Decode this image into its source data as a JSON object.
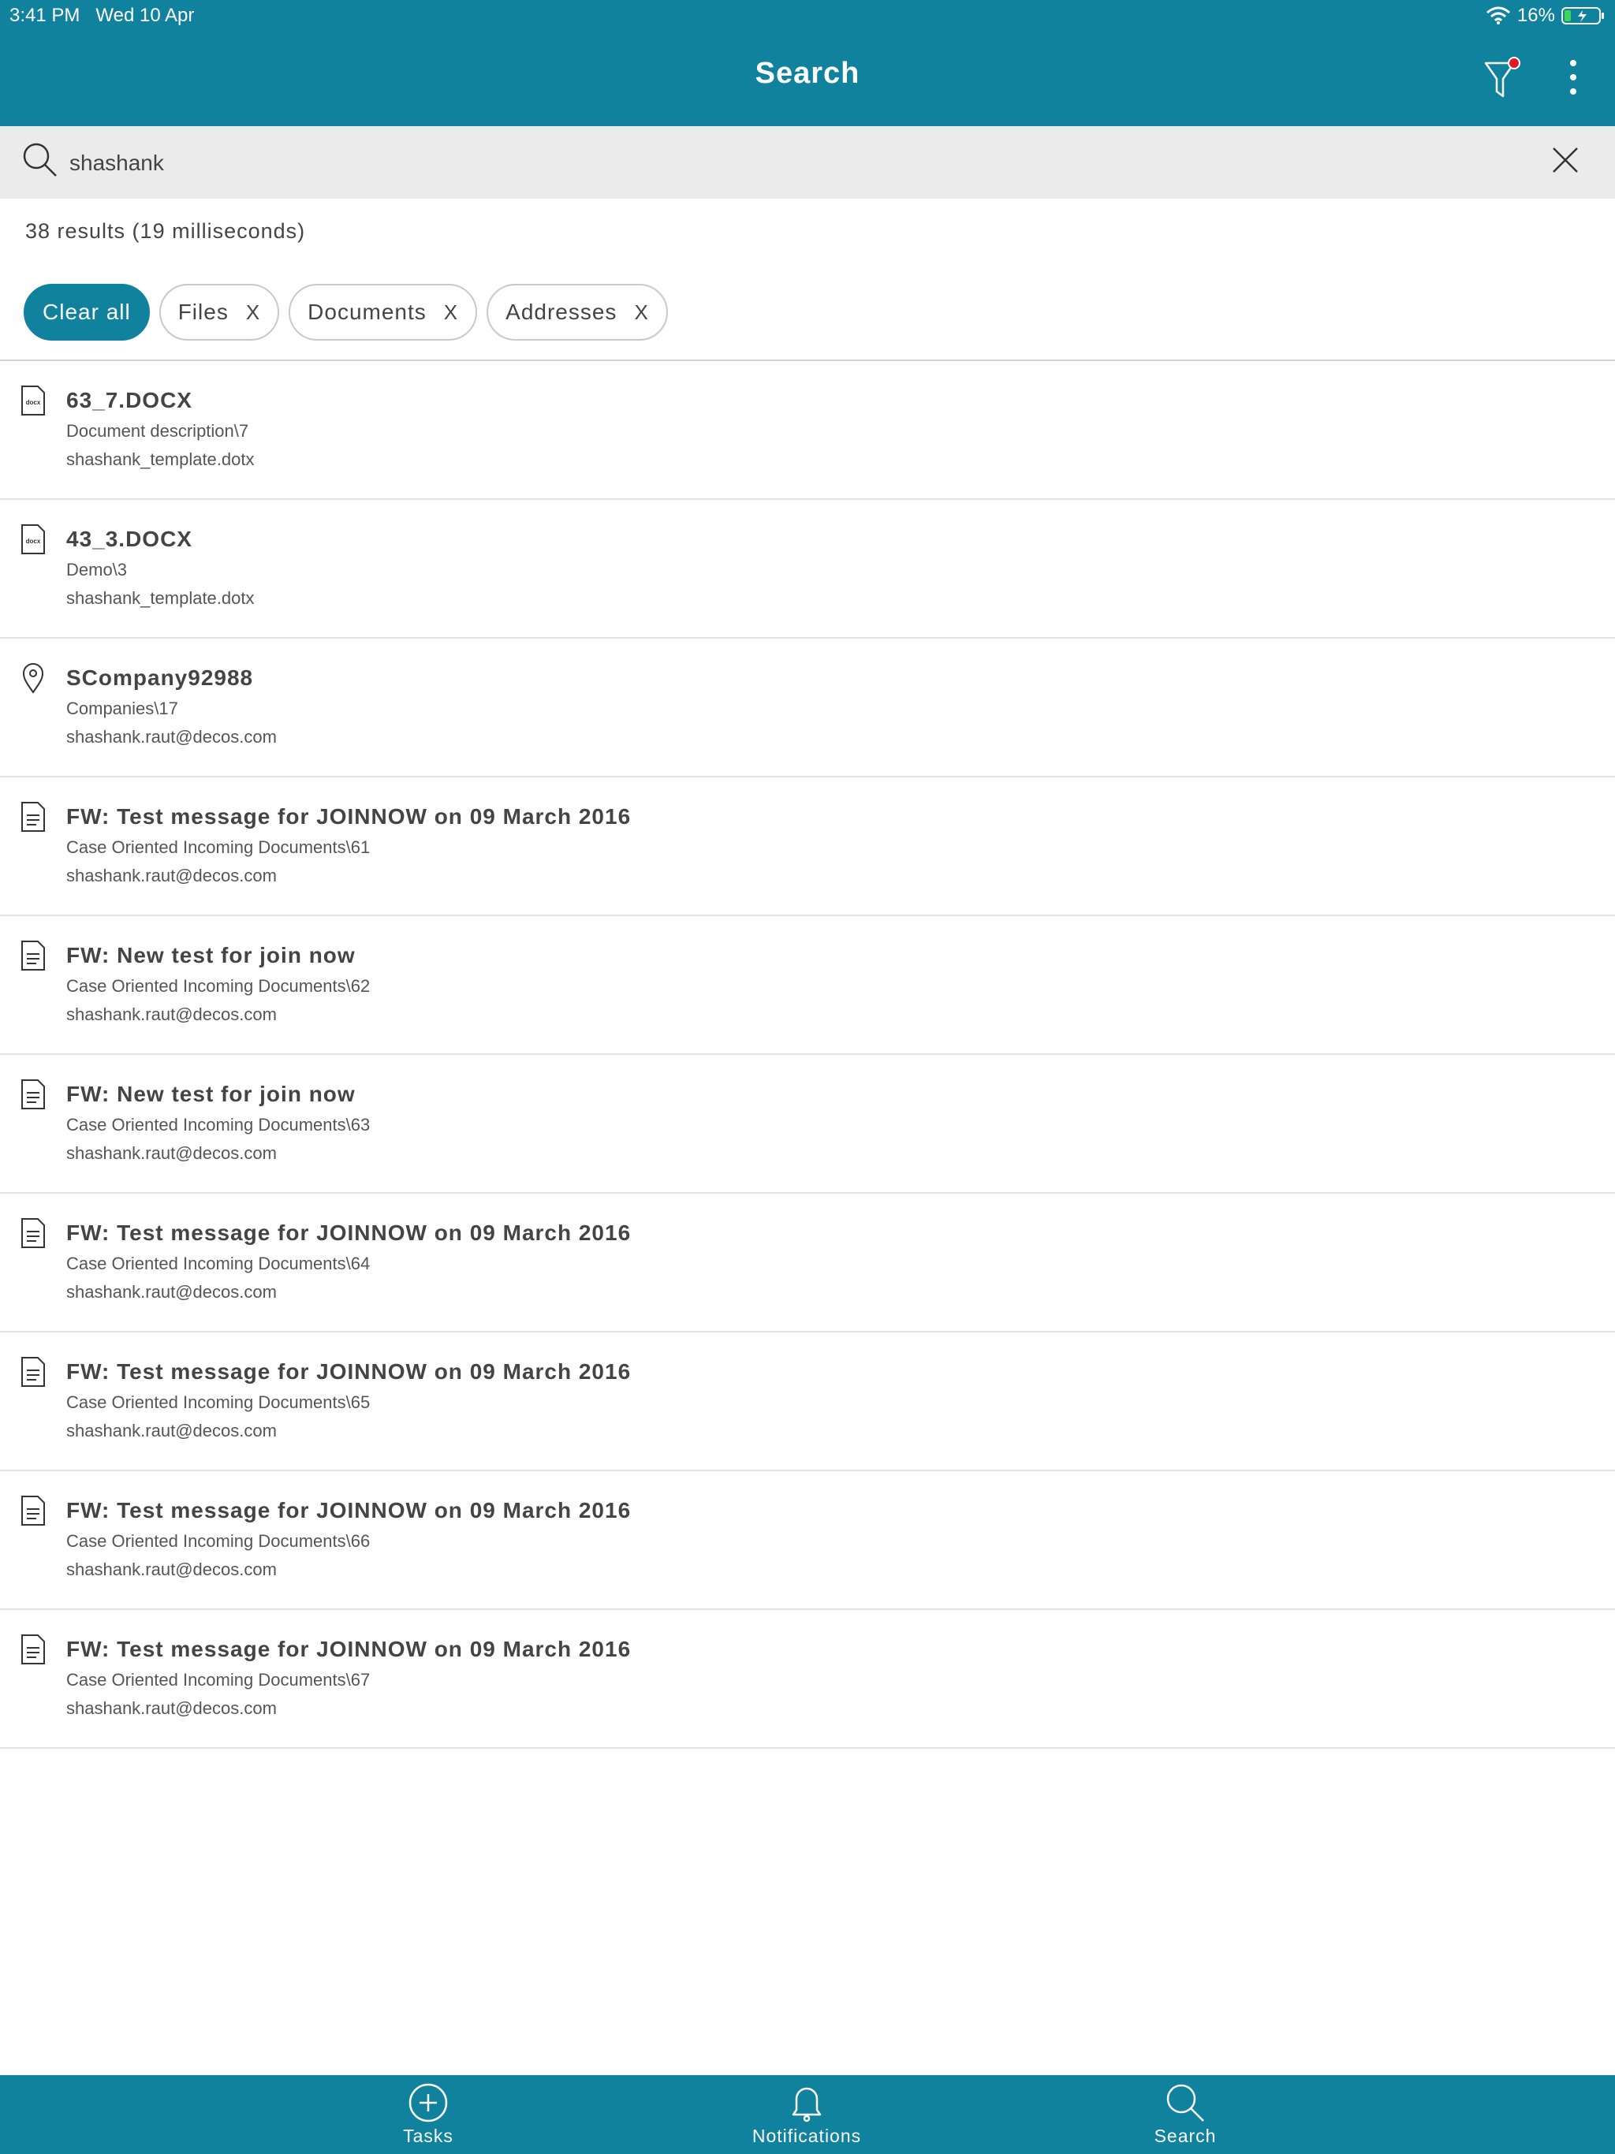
{
  "status_bar": {
    "time": "3:41 PM",
    "date": "Wed 10 Apr",
    "battery": "16%"
  },
  "header": {
    "title": "Search"
  },
  "search": {
    "query": "shashank",
    "placeholder": ""
  },
  "results_summary": "38 results (19 milliseconds)",
  "filters": {
    "clear_all": "Clear all",
    "chips": [
      {
        "label": "Files",
        "remove": "X"
      },
      {
        "label": "Documents",
        "remove": "X"
      },
      {
        "label": "Addresses",
        "remove": "X"
      }
    ]
  },
  "results": [
    {
      "icon": "docx-file-icon",
      "title": "63_7.DOCX",
      "path": "Document description\\7",
      "meta": "shashank_template.dotx"
    },
    {
      "icon": "docx-file-icon",
      "title": "43_3.DOCX",
      "path": "Demo\\3",
      "meta": "shashank_template.dotx"
    },
    {
      "icon": "location-pin-icon",
      "title": "SCompany92988",
      "path": "Companies\\17",
      "meta": "shashank.raut@decos.com"
    },
    {
      "icon": "document-icon",
      "title": "FW: Test message for JOINNOW on 09 March 2016",
      "path": "Case Oriented Incoming Documents\\61",
      "meta": "shashank.raut@decos.com"
    },
    {
      "icon": "document-icon",
      "title": "FW: New test for join now",
      "path": "Case Oriented Incoming Documents\\62",
      "meta": "shashank.raut@decos.com"
    },
    {
      "icon": "document-icon",
      "title": "FW: New test for join now",
      "path": "Case Oriented Incoming Documents\\63",
      "meta": "shashank.raut@decos.com"
    },
    {
      "icon": "document-icon",
      "title": "FW: Test message for JOINNOW on 09 March 2016",
      "path": "Case Oriented Incoming Documents\\64",
      "meta": "shashank.raut@decos.com"
    },
    {
      "icon": "document-icon",
      "title": "FW: Test message for JOINNOW on 09 March 2016",
      "path": "Case Oriented Incoming Documents\\65",
      "meta": "shashank.raut@decos.com"
    },
    {
      "icon": "document-icon",
      "title": "FW: Test message for JOINNOW on 09 March 2016",
      "path": "Case Oriented Incoming Documents\\66",
      "meta": "shashank.raut@decos.com"
    },
    {
      "icon": "document-icon",
      "title": "FW: Test message for JOINNOW on 09 March 2016",
      "path": "Case Oriented Incoming Documents\\67",
      "meta": "shashank.raut@decos.com"
    }
  ],
  "tabs": [
    {
      "icon": "add-circle-icon",
      "label": "Tasks"
    },
    {
      "icon": "bell-icon",
      "label": "Notifications"
    },
    {
      "icon": "search-icon",
      "label": "Search"
    }
  ],
  "colors": {
    "brand": "#10829e",
    "filter_badge": "#e0192a"
  }
}
